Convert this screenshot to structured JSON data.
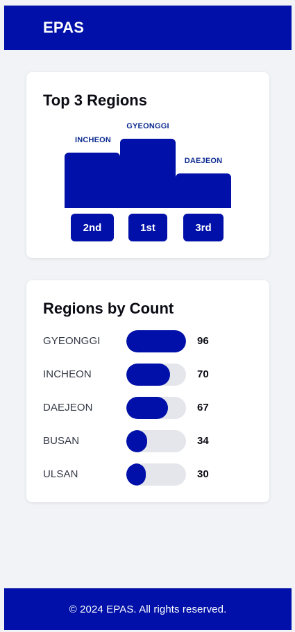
{
  "header": {
    "brand": "EPAS"
  },
  "top_regions": {
    "title": "Top 3 Regions",
    "podium": [
      {
        "name": "INCHEON",
        "rank_label": "2nd"
      },
      {
        "name": "GYEONGGI",
        "rank_label": "1st"
      },
      {
        "name": "DAEJEON",
        "rank_label": "3rd"
      }
    ]
  },
  "regions_by_count": {
    "title": "Regions by Count",
    "max": 96,
    "rows": [
      {
        "label": "GYEONGGI",
        "value": 96
      },
      {
        "label": "INCHEON",
        "value": 70
      },
      {
        "label": "DAEJEON",
        "value": 67
      },
      {
        "label": "BUSAN",
        "value": 34
      },
      {
        "label": "ULSAN",
        "value": 30
      }
    ]
  },
  "footer": {
    "text": "© 2024 EPAS. All rights reserved."
  },
  "colors": {
    "brand": "#0010a8",
    "track": "#e4e6eb",
    "page_bg": "#f1f3f7"
  }
}
